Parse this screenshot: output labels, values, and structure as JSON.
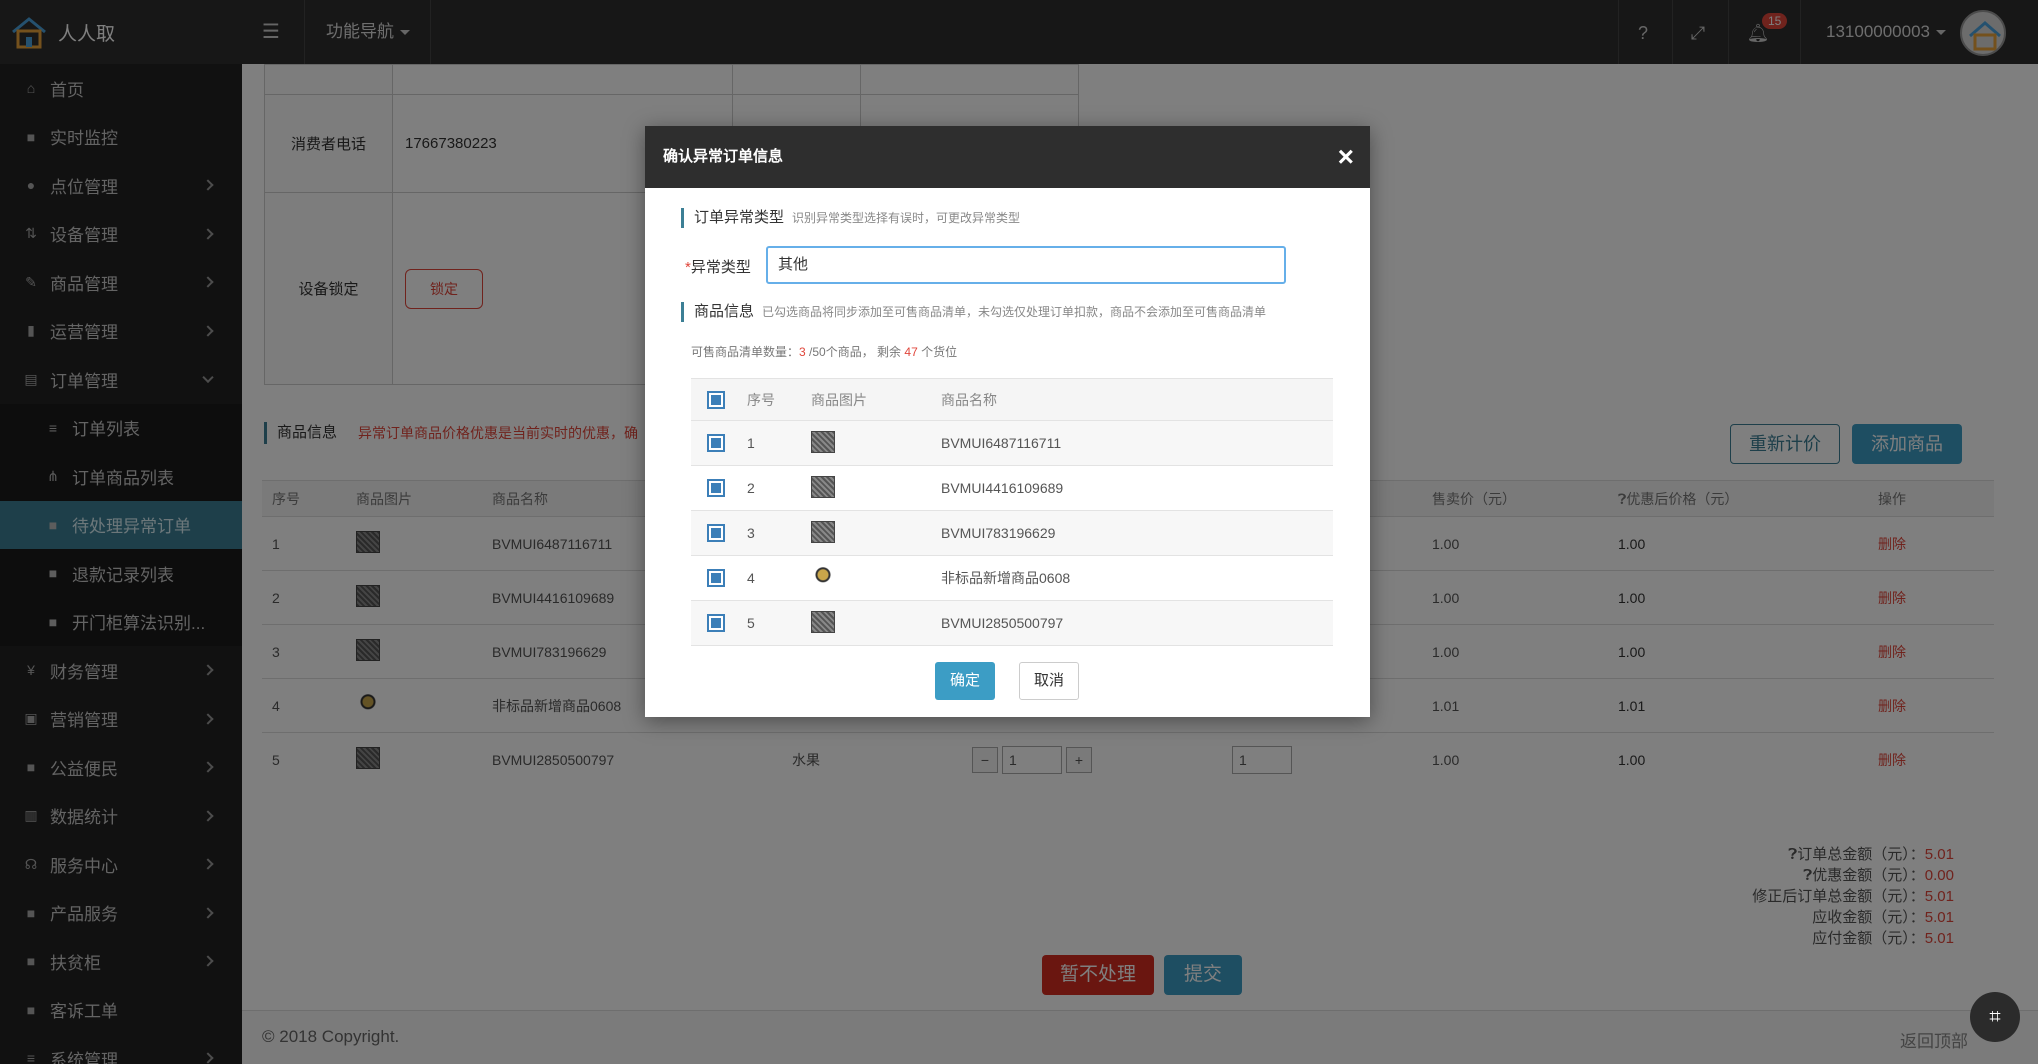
{
  "app": {
    "name": "人人取"
  },
  "topbar": {
    "nav_label": "功能导航",
    "notifications": "15",
    "user": "13100000003"
  },
  "sidebar": [
    {
      "label": "首页",
      "icon": "home-icon",
      "glyph": "⌂",
      "chevron": ""
    },
    {
      "label": "实时监控",
      "icon": "video-camera-icon",
      "glyph": "■",
      "chevron": ""
    },
    {
      "label": "点位管理",
      "icon": "map-marker-icon",
      "glyph": "●",
      "chevron": "right"
    },
    {
      "label": "设备管理",
      "icon": "sort-icon",
      "glyph": "⇅",
      "chevron": "right"
    },
    {
      "label": "商品管理",
      "icon": "edit-icon",
      "glyph": "✎",
      "chevron": "right"
    },
    {
      "label": "运营管理",
      "icon": "bookmark-icon",
      "glyph": "▮",
      "chevron": "right"
    },
    {
      "label": "订单管理",
      "icon": "order-icon",
      "glyph": "▤",
      "chevron": "down"
    },
    {
      "label": "订单列表",
      "icon": "list-icon",
      "glyph": "≡",
      "chevron": "",
      "sub": true
    },
    {
      "label": "订单商品列表",
      "icon": "sitemap-icon",
      "glyph": "⋔",
      "chevron": "",
      "sub": true
    },
    {
      "label": "待处理异常订单",
      "icon": "square-icon",
      "glyph": "■",
      "chevron": "",
      "sub": true,
      "active": true
    },
    {
      "label": "退款记录列表",
      "icon": "square-icon",
      "glyph": "■",
      "chevron": "",
      "sub": true
    },
    {
      "label": "开门柜算法识别...",
      "icon": "square-icon",
      "glyph": "■",
      "chevron": "",
      "sub": true
    },
    {
      "label": "财务管理",
      "icon": "yen-icon",
      "glyph": "¥",
      "chevron": "right"
    },
    {
      "label": "营销管理",
      "icon": "gift-icon",
      "glyph": "▣",
      "chevron": "right"
    },
    {
      "label": "公益便民",
      "icon": "square-icon",
      "glyph": "■",
      "chevron": "right"
    },
    {
      "label": "数据统计",
      "icon": "bar-chart-icon",
      "glyph": "▥",
      "chevron": "right"
    },
    {
      "label": "服务中心",
      "icon": "headset-icon",
      "glyph": "☊",
      "chevron": "right"
    },
    {
      "label": "产品服务",
      "icon": "square-icon",
      "glyph": "■",
      "chevron": "right"
    },
    {
      "label": "扶贫柜",
      "icon": "square-icon",
      "glyph": "■",
      "chevron": "right"
    },
    {
      "label": "客诉工单",
      "icon": "square-icon",
      "glyph": "■",
      "chevron": ""
    },
    {
      "label": "系统管理",
      "icon": "list-icon",
      "glyph": "≡",
      "chevron": "right"
    }
  ],
  "order_form": {
    "phone_label": "消费者电话",
    "phone_value": "17667380223",
    "lock_label": "设备锁定",
    "lock_button": "锁定"
  },
  "goods_section": {
    "title": "商品信息",
    "warning": "异常订单商品价格优惠是当前实时的优惠，确",
    "recalc_button": "重新计价",
    "add_button": "添加商品",
    "columns": [
      "序号",
      "商品图片",
      "商品名称",
      "",
      "",
      "",
      "售卖价（元）",
      "优惠后价格（元）",
      "操作"
    ],
    "rows": [
      {
        "no": "1",
        "img": "qr",
        "name": "BVMUI6487116711",
        "sale": "1.00",
        "disc": "1.00",
        "op": "删除"
      },
      {
        "no": "2",
        "img": "qr",
        "name": "BVMUI4416109689",
        "sale": "1.00",
        "disc": "1.00",
        "op": "删除"
      },
      {
        "no": "3",
        "img": "qr",
        "name": "BVMUI783196629",
        "sale": "1.00",
        "disc": "1.00",
        "op": "删除"
      },
      {
        "no": "4",
        "img": "fig",
        "name": "非标品新增商品0608",
        "sale": "1.01",
        "disc": "1.01",
        "op": "删除"
      },
      {
        "no": "5",
        "img": "qr",
        "name": "BVMUI2850500797",
        "cat": "水果",
        "qty": "1",
        "qty2": "1",
        "sale": "1.00",
        "disc": "1.00",
        "op": "删除"
      }
    ]
  },
  "totals": {
    "order_total_label": "订单总金额（元）：",
    "order_total": "5.01",
    "discount_label": "优惠金额（元）：",
    "discount": "0.00",
    "corrected_label": "修正后订单总金额（元）：",
    "corrected": "5.01",
    "receivable_label": "应收金额（元）：",
    "receivable": "5.01",
    "payable_label": "应付金额（元）：",
    "payable": "5.01"
  },
  "actions": {
    "hold": "暂不处理",
    "submit": "提交"
  },
  "footer": {
    "copyright": "© 2018 Copyright.",
    "back_top": "返回顶部"
  },
  "modal": {
    "title": "确认异常订单信息",
    "type_section": "订单异常类型",
    "type_hint": "识别异常类型选择有误时，可更改异常类型",
    "type_label": "异常类型",
    "type_value": "其他",
    "goods_section": "商品信息",
    "goods_hint": "已勾选商品将同步添加至可售商品清单，未勾选仅处理订单扣款，商品不会添加至可售商品清单",
    "count_prefix": "可售商品清单数量：",
    "count_used": "3",
    "count_mid": " /50个商品， 剩余 ",
    "count_left": "47",
    "count_suffix": " 个货位",
    "columns": [
      "序号",
      "商品图片",
      "商品名称"
    ],
    "rows": [
      {
        "no": "1",
        "img": "qr",
        "name": "BVMUI6487116711"
      },
      {
        "no": "2",
        "img": "qr",
        "name": "BVMUI4416109689"
      },
      {
        "no": "3",
        "img": "qr",
        "name": "BVMUI783196629"
      },
      {
        "no": "4",
        "img": "fig",
        "name": "非标品新增商品0608"
      },
      {
        "no": "5",
        "img": "qr",
        "name": "BVMUI2850500797"
      }
    ],
    "ok": "确定",
    "cancel": "取消"
  }
}
